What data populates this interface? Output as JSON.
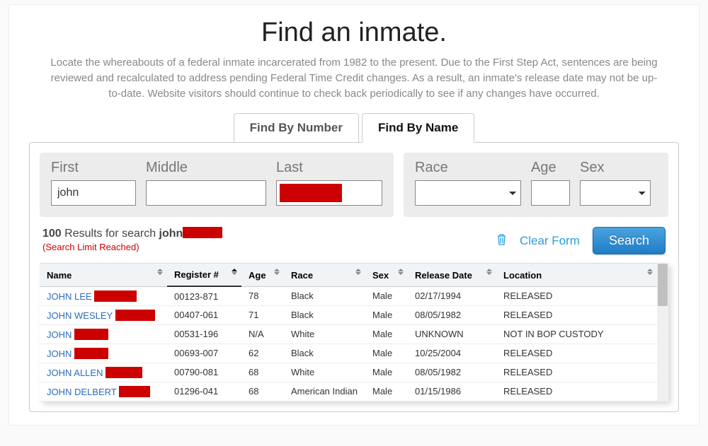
{
  "header": {
    "title": "Find an inmate.",
    "intro": "Locate the whereabouts of a federal inmate incarcerated from 1982 to the present. Due to the First Step Act, sentences are being reviewed and recalculated to address pending Federal Time Credit changes. As a result, an inmate's release date may not be up-to-date. Website visitors should continue to check back periodically to see if any changes have occurred."
  },
  "tabs": {
    "by_number": "Find By Number",
    "by_name": "Find By Name"
  },
  "form": {
    "first_label": "First",
    "first_value": "john",
    "middle_label": "Middle",
    "middle_value": "",
    "last_label": "Last",
    "last_value": "",
    "race_label": "Race",
    "age_label": "Age",
    "sex_label": "Sex"
  },
  "results": {
    "count": "100",
    "prefix": "Results for search",
    "query": "john",
    "limit": "(Search Limit Reached)",
    "clear": "Clear Form",
    "search": "Search"
  },
  "columns": {
    "name": "Name",
    "register": "Register #",
    "age": "Age",
    "race": "Race",
    "sex": "Sex",
    "release": "Release Date",
    "location": "Location"
  },
  "rows": [
    {
      "name_prefix": "JOHN LEE",
      "red_w": 60,
      "register": "00123-871",
      "age": "78",
      "race": "Black",
      "sex": "Male",
      "release": "02/17/1994",
      "location": "RELEASED"
    },
    {
      "name_prefix": "JOHN WESLEY",
      "red_w": 56,
      "register": "00407-061",
      "age": "71",
      "race": "Black",
      "sex": "Male",
      "release": "08/05/1982",
      "location": "RELEASED"
    },
    {
      "name_prefix": "JOHN",
      "red_w": 48,
      "register": "00531-196",
      "age": "N/A",
      "race": "White",
      "sex": "Male",
      "release": "UNKNOWN",
      "location": "NOT IN BOP CUSTODY"
    },
    {
      "name_prefix": "JOHN",
      "red_w": 48,
      "register": "00693-007",
      "age": "62",
      "race": "Black",
      "sex": "Male",
      "release": "10/25/2004",
      "location": "RELEASED"
    },
    {
      "name_prefix": "JOHN ALLEN",
      "red_w": 52,
      "register": "00790-081",
      "age": "68",
      "race": "White",
      "sex": "Male",
      "release": "08/05/1982",
      "location": "RELEASED"
    },
    {
      "name_prefix": "JOHN DELBERT",
      "red_w": 44,
      "register": "01296-041",
      "age": "68",
      "race": "American Indian",
      "sex": "Male",
      "release": "01/15/1986",
      "location": "RELEASED"
    }
  ]
}
